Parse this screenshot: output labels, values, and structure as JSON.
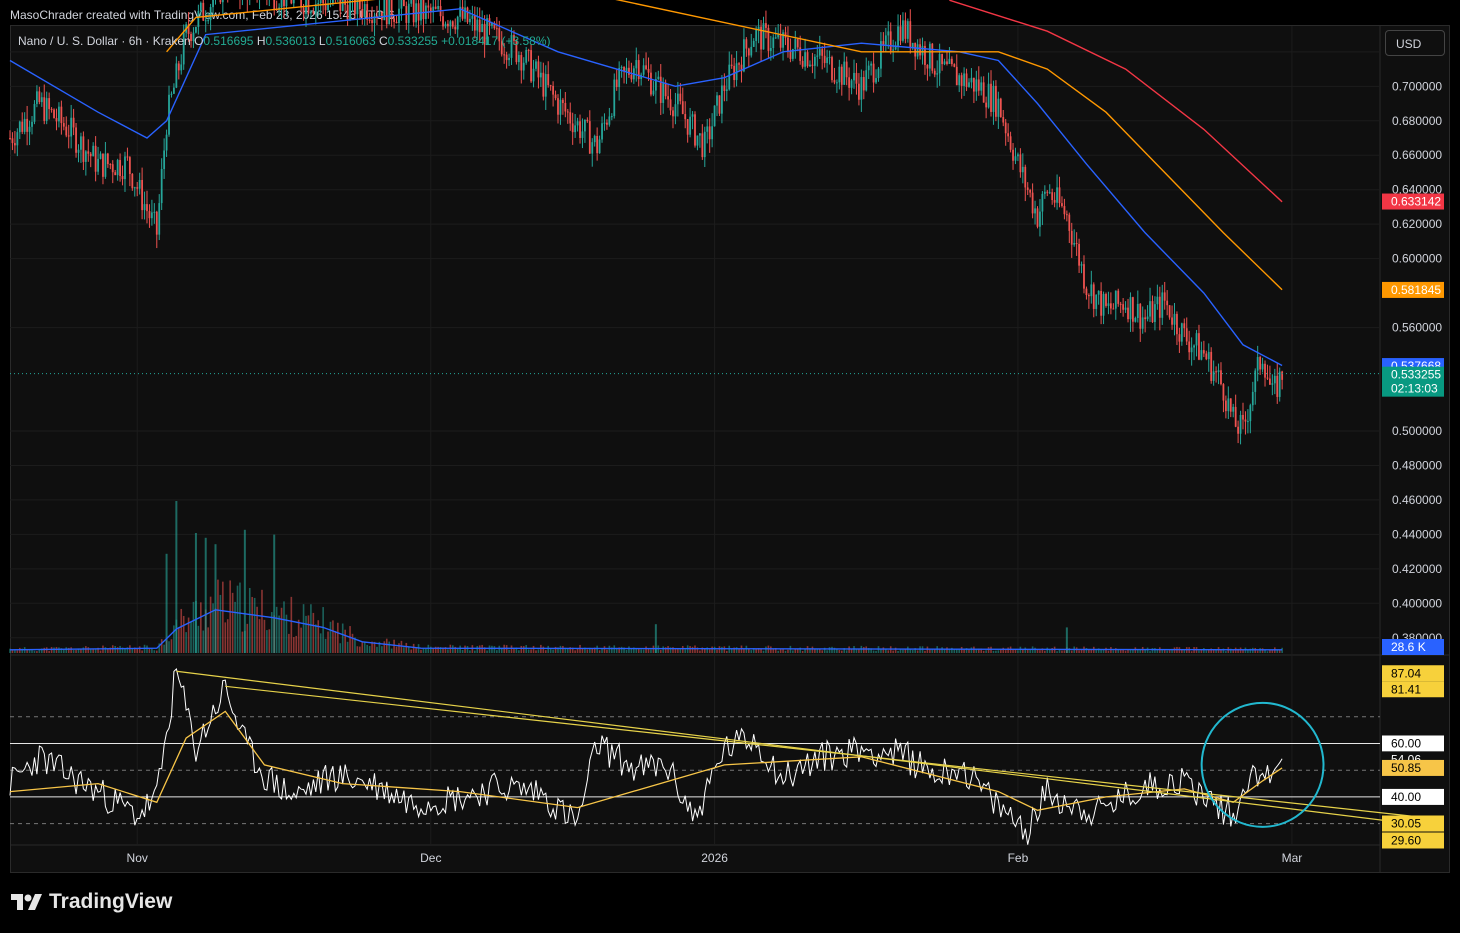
{
  "header": {
    "text": "MasoChrader created with TradingView.com, Feb 28, 2026 15:46 UTC-6"
  },
  "legend": {
    "symbol": "Nano / U. S. Dollar · 6h · Kraken",
    "o_label": "O",
    "o_value": "0.516695",
    "h_label": "H",
    "h_value": "0.536013",
    "l_label": "L",
    "l_value": "0.516063",
    "c_label": "C",
    "c_value": "0.533255",
    "change": "+0.018417 (+3.58%)"
  },
  "currency_button": "USD",
  "brand": "TradingView",
  "colors": {
    "up": "#26a69a",
    "down": "#ef5350",
    "ma_fast": "#2962ff",
    "ma_mid": "#ff9800",
    "ma_slow": "#f23645",
    "rsi": "#ffffff",
    "rsi_ma": "#f7c548",
    "trendline": "#e6d24a",
    "highlight_circle": "#22b8cf"
  },
  "price_badges": [
    {
      "text": "0.633142",
      "color": "#f23645"
    },
    {
      "text": "0.581845",
      "color": "#ff9800"
    },
    {
      "text": "0.537668",
      "color": "#2962ff"
    },
    {
      "text": "0.533255",
      "color": "#089981"
    },
    {
      "text": "02:13:03",
      "color": "#089981"
    }
  ],
  "volume_badge": {
    "text": "28.6 K",
    "color": "#2962ff"
  },
  "rsi_badges": [
    {
      "text": "87.04",
      "color": "#f7d13b"
    },
    {
      "text": "81.41",
      "color": "#f7d13b"
    },
    {
      "text": "60.00",
      "color": "#ffffff"
    },
    {
      "text": "54.06",
      "color": "#0f0f0f"
    },
    {
      "text": "50.85",
      "color": "#f7c548"
    },
    {
      "text": "40.00",
      "color": "#ffffff"
    },
    {
      "text": "30.05",
      "color": "#f7d13b"
    },
    {
      "text": "29.60",
      "color": "#f7d13b"
    }
  ],
  "chart_data": [
    {
      "type": "candlestick",
      "title": "Nano / U. S. Dollar · 6h · Kraken",
      "y_axis": {
        "min": 0.37,
        "max": 0.735,
        "ticks": [
          "0.720000",
          "0.700000",
          "0.680000",
          "0.660000",
          "0.640000",
          "0.620000",
          "0.600000",
          "0.560000",
          "0.500000",
          "0.480000",
          "0.460000",
          "0.440000",
          "0.420000",
          "0.400000",
          "0.380000"
        ]
      },
      "x_axis": {
        "ticks": [
          "Nov",
          "Dec",
          "2026",
          "Feb",
          "Mar"
        ],
        "time_range": [
          "Oct 21",
          "Mar 10"
        ]
      },
      "grid": true,
      "price_path": [
        [
          "Oct 21",
          0.67
        ],
        [
          "Oct 24",
          0.69
        ],
        [
          "Oct 27",
          0.675
        ],
        [
          "Oct 30",
          0.655
        ],
        [
          "Nov 2",
          0.655
        ],
        [
          "Nov 5",
          0.615
        ],
        [
          "Nov 6",
          0.68
        ],
        [
          "Nov 8",
          0.73
        ],
        [
          "Nov 12",
          0.76
        ],
        [
          "Nov 20",
          0.75
        ],
        [
          "Nov 28",
          0.745
        ],
        [
          "Dec 6",
          0.74
        ],
        [
          "Dec 12",
          0.72
        ],
        [
          "Dec 16",
          0.69
        ],
        [
          "Dec 20",
          0.665
        ],
        [
          "Dec 22",
          0.7
        ],
        [
          "Dec 24",
          0.715
        ],
        [
          "Dec 26",
          0.7
        ],
        [
          "Dec 28",
          0.69
        ],
        [
          "Dec 31",
          0.665
        ],
        [
          "Jan 2",
          0.7
        ],
        [
          "Jan 5",
          0.73
        ],
        [
          "Jan 10",
          0.72
        ],
        [
          "Jan 12",
          0.715
        ],
        [
          "Jan 16",
          0.7
        ],
        [
          "Jan 20",
          0.735
        ],
        [
          "Jan 24",
          0.71
        ],
        [
          "Jan 28",
          0.7
        ],
        [
          "Jan 30",
          0.69
        ],
        [
          "Feb 1",
          0.655
        ],
        [
          "Feb 3",
          0.625
        ],
        [
          "Feb 4",
          0.64
        ],
        [
          "Feb 6",
          0.625
        ],
        [
          "Feb 8",
          0.585
        ],
        [
          "Feb 10",
          0.57
        ],
        [
          "Feb 12",
          0.575
        ],
        [
          "Feb 14",
          0.565
        ],
        [
          "Feb 16",
          0.575
        ],
        [
          "Feb 18",
          0.555
        ],
        [
          "Feb 20",
          0.545
        ],
        [
          "Feb 22",
          0.525
        ],
        [
          "Feb 23",
          0.505
        ],
        [
          "Feb 24",
          0.5
        ],
        [
          "Feb 25",
          0.525
        ],
        [
          "Feb 26",
          0.545
        ],
        [
          "Feb 27",
          0.52
        ],
        [
          "Feb 28",
          0.533
        ]
      ],
      "moving_averages": [
        {
          "color": "blue",
          "last": 0.537668,
          "path": [
            [
              "Oct 21",
              0.715
            ],
            [
              "Oct 30",
              0.685
            ],
            [
              "Nov 4",
              0.67
            ],
            [
              "Nov 6",
              0.68
            ],
            [
              "Nov 10",
              0.73
            ],
            [
              "Dec 6",
              0.745
            ],
            [
              "Dec 16",
              0.72
            ],
            [
              "Dec 28",
              0.7
            ],
            [
              "Jan 2",
              0.705
            ],
            [
              "Jan 8",
              0.72
            ],
            [
              "Jan 16",
              0.725
            ],
            [
              "Jan 26",
              0.72
            ],
            [
              "Jan 30",
              0.715
            ],
            [
              "Feb 3",
              0.69
            ],
            [
              "Feb 8",
              0.655
            ],
            [
              "Feb 14",
              0.615
            ],
            [
              "Feb 20",
              0.58
            ],
            [
              "Feb 24",
              0.55
            ],
            [
              "Feb 28",
              0.538
            ]
          ]
        },
        {
          "color": "orange",
          "last": 0.581845,
          "path": [
            [
              "Nov 6",
              0.72
            ],
            [
              "Nov 9",
              0.74
            ],
            [
              "Dec 14",
              0.76
            ],
            [
              "Jan 16",
              0.72
            ],
            [
              "Jan 30",
              0.72
            ],
            [
              "Feb 4",
              0.71
            ],
            [
              "Feb 10",
              0.685
            ],
            [
              "Feb 16",
              0.65
            ],
            [
              "Feb 22",
              0.615
            ],
            [
              "Feb 28",
              0.582
            ]
          ]
        },
        {
          "color": "red",
          "last": 0.633142,
          "path": [
            [
              "Jan 25",
              0.75
            ],
            [
              "Feb 4",
              0.732
            ],
            [
              "Feb 12",
              0.71
            ],
            [
              "Feb 20",
              0.675
            ],
            [
              "Feb 28",
              0.633
            ]
          ]
        }
      ],
      "current_price": 0.533255
    },
    {
      "type": "bar",
      "title": "Volume",
      "last_value": "28.6 K",
      "spikes": [
        {
          "date": "Nov 6",
          "level": 0.62
        },
        {
          "date": "Nov 7",
          "level": 0.95
        },
        {
          "date": "Nov 9",
          "level": 0.75
        },
        {
          "date": "Nov 10",
          "level": 0.72
        },
        {
          "date": "Nov 11",
          "level": 0.68
        },
        {
          "date": "Nov 14",
          "level": 0.77
        },
        {
          "date": "Nov 17",
          "level": 0.74
        },
        {
          "date": "Dec 26",
          "level": 0.18
        },
        {
          "date": "Feb 6",
          "level": 0.16
        }
      ],
      "moving_average": [
        [
          "Oct 21",
          0.02
        ],
        [
          "Nov 5",
          0.03
        ],
        [
          "Nov 7",
          0.15
        ],
        [
          "Nov 11",
          0.27
        ],
        [
          "Nov 17",
          0.22
        ],
        [
          "Nov 22",
          0.16
        ],
        [
          "Nov 26",
          0.07
        ],
        [
          "Dec 2",
          0.03
        ],
        [
          "Feb 28",
          0.02
        ]
      ]
    },
    {
      "type": "line",
      "title": "RSI",
      "y_axis": {
        "min": 22,
        "max": 92
      },
      "levels": {
        "upper_dashed": 70,
        "upper": 60,
        "mid_dashed": 50,
        "lower": 40,
        "lower_dashed": 30
      },
      "series": [
        {
          "color": "white",
          "values": [
            [
              "Oct 21",
              45
            ],
            [
              "Oct 24",
              55
            ],
            [
              "Oct 27",
              48
            ],
            [
              "Oct 30",
              42
            ],
            [
              "Nov 3",
              33
            ],
            [
              "Nov 5",
              40
            ],
            [
              "Nov 7",
              87
            ],
            [
              "Nov 9",
              58
            ],
            [
              "Nov 12",
              81
            ],
            [
              "Nov 14",
              60
            ],
            [
              "Nov 16",
              48
            ],
            [
              "Nov 19",
              40
            ],
            [
              "Nov 23",
              48
            ],
            [
              "Nov 27",
              45
            ],
            [
              "Dec 1",
              38
            ],
            [
              "Dec 6",
              40
            ],
            [
              "Dec 10",
              44
            ],
            [
              "Dec 14",
              42
            ],
            [
              "Dec 18",
              30
            ],
            [
              "Dec 20",
              60
            ],
            [
              "Dec 24",
              50
            ],
            [
              "Dec 27",
              52
            ],
            [
              "Dec 30",
              32
            ],
            [
              "Jan 2",
              58
            ],
            [
              "Jan 5",
              62
            ],
            [
              "Jan 8",
              47
            ],
            [
              "Jan 12",
              55
            ],
            [
              "Jan 16",
              58
            ],
            [
              "Jan 20",
              56
            ],
            [
              "Jan 24",
              48
            ],
            [
              "Jan 26",
              52
            ],
            [
              "Jan 30",
              36
            ],
            [
              "Feb 2",
              28
            ],
            [
              "Feb 4",
              42
            ],
            [
              "Feb 6",
              38
            ],
            [
              "Feb 9",
              34
            ],
            [
              "Feb 12",
              40
            ],
            [
              "Feb 15",
              45
            ],
            [
              "Feb 18",
              46
            ],
            [
              "Feb 21",
              38
            ],
            [
              "Feb 23",
              33
            ],
            [
              "Feb 24",
              40
            ],
            [
              "Feb 25",
              55
            ],
            [
              "Feb 26",
              44
            ],
            [
              "Feb 27",
              52
            ],
            [
              "Feb 28",
              54.06
            ]
          ]
        },
        {
          "color": "yellow",
          "values": [
            [
              "Oct 21",
              42
            ],
            [
              "Oct 30",
              45
            ],
            [
              "Nov 5",
              38
            ],
            [
              "Nov 8",
              62
            ],
            [
              "Nov 12",
              72
            ],
            [
              "Nov 16",
              52
            ],
            [
              "Nov 24",
              45
            ],
            [
              "Dec 6",
              42
            ],
            [
              "Dec 18",
              36
            ],
            [
              "Jan 2",
              52
            ],
            [
              "Jan 16",
              55
            ],
            [
              "Jan 30",
              42
            ],
            [
              "Feb 3",
              35
            ],
            [
              "Feb 10",
              40
            ],
            [
              "Feb 18",
              43
            ],
            [
              "Feb 23",
              38
            ],
            [
              "Feb 26",
              46
            ],
            [
              "Feb 28",
              50.85
            ]
          ]
        }
      ],
      "trendlines": [
        {
          "from": [
            "Nov 7",
            87.04
          ],
          "to": [
            "Mar 14",
            29.6
          ]
        },
        {
          "from": [
            "Nov 12",
            81.41
          ],
          "to": [
            "Mar 14",
            32.5
          ]
        }
      ],
      "annotation": {
        "shape": "ellipse",
        "around": "Feb 21 – Mar 3"
      }
    }
  ]
}
